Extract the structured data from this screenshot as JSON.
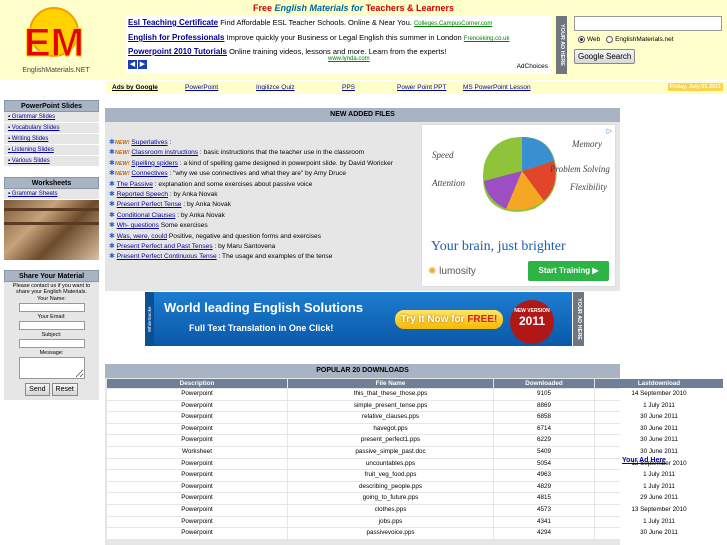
{
  "header": {
    "tagline_free": "Free",
    "tagline_em": "English Materials",
    "tagline_for": "for",
    "tagline_tl": "Teachers & Learners",
    "logo_text": "EM",
    "logo_sub": "EnglishMaterials.NET",
    "top_ads": [
      {
        "title": "Esl Teaching Certificate",
        "desc": "Find Affordable ESL Teacher Schools. Online & Near You.",
        "url": "Colleges.CampusCorner.com"
      },
      {
        "title": "English for Professionals",
        "desc": "Improve quickly your Business or Legal English this summer in London",
        "url": "Frenceking.co.uk"
      },
      {
        "title": "Powerpoint 2010 Tutorials",
        "desc": "Online training videos, lessons and more. Learn from the experts!",
        "url": "www.lynda.com"
      }
    ],
    "adchoices": "AdChoices",
    "nav_prev": "◀",
    "nav_next": "▶",
    "your_ad_here_vertical": "YOUR AD HERE",
    "search": {
      "input_value": "",
      "radio_web": "Web",
      "radio_site": "EnglishMaterials.net",
      "button": "Google Search"
    }
  },
  "navbar": {
    "ads_by_google": "Ads by Google",
    "links": [
      "PowerPoint",
      "Ingilizce Quiz",
      "PPS",
      "Power Point PPT",
      "MS PowerPoint Lesson"
    ],
    "date": "Friday, July 01 2011"
  },
  "sidebar": {
    "ppt_title": "PowerPoint Slides",
    "ppt_items": [
      "Grammar Slides",
      "Vocabulary Slides",
      "Writing Slides",
      "Listening Slides",
      "Various Slides"
    ],
    "ws_title": "Worksheets",
    "ws_items": [
      "Grammar Sheets"
    ],
    "share": {
      "title": "Share Your Material",
      "intro": "Please contact us if you want to share your English Materials.",
      "name": "Your Name:",
      "email": "Your Email:",
      "subject": "Subject:",
      "message": "Message:",
      "send": "Send",
      "reset": "Reset"
    }
  },
  "newfiles": {
    "title": "NEW ADDED FILES",
    "new_tag": "NEW!",
    "items": [
      {
        "link": "Superlatives",
        "text": " :",
        "new": true
      },
      {
        "link": "Classroom instructions",
        "text": " : basic instructions that the teacher use in the classroom",
        "new": true
      },
      {
        "link": "Spelling spiders",
        "text": " : a kind of spelling game designed in powerpoint slide. by David Woricker",
        "new": true
      },
      {
        "link": "Connectives",
        "text": " : \"why we use connectives and what they are\" by Amy Druce",
        "new": true
      },
      {
        "link": "The Passive",
        "text": " : explanation and some exercises about passive voice",
        "new": false
      },
      {
        "link": "Reported Speech",
        "text": " : by Anka Novak",
        "new": false
      },
      {
        "link": "Present Perfect Tense",
        "text": " : by Anka Novak",
        "new": false
      },
      {
        "link": "Conditional Clauses",
        "text": " : by Anka Novak",
        "new": false
      },
      {
        "link": "Wh- questions",
        "text": " Some exercises",
        "new": false
      },
      {
        "link": "Was, were, could",
        "text": " Positive, negative and question forms and exercises",
        "new": false
      },
      {
        "link": "Present Perfect and Past Tenses",
        "text": " : by Maru Santovena",
        "new": false
      },
      {
        "link": "Present Perfect Continuous Tense",
        "text": " : The usage and examples of the tense",
        "new": false
      }
    ]
  },
  "brain_ad": {
    "labels": [
      "Memory",
      "Speed",
      "Problem Solving",
      "Attention",
      "Flexibility"
    ],
    "headline": "Your brain, just brighter",
    "brand": "lumosity",
    "button": "Start Training ▶",
    "adchoice_icon": "▷"
  },
  "banner": {
    "title": "World leading English Solutions",
    "subtitle": "Full Text Translation in One Click!",
    "try": "Try It Now for ",
    "free": "FREE!",
    "badge_top": "NEW VERSION",
    "badge_year": "2011",
    "side": "WhiteSmoke"
  },
  "popular": {
    "title": "POPULAR 20 DOWNLOADS",
    "columns": [
      "Description",
      "File Name",
      "Downloaded",
      "Lastdownload"
    ],
    "rows": [
      [
        "Powerpoint",
        "this_that_these_those.pps",
        "9105",
        "14 September 2010"
      ],
      [
        "Powerpoint",
        "simple_present_tense.pps",
        "8869",
        "1 July 2011"
      ],
      [
        "Powerpoint",
        "relative_clauses.pps",
        "6858",
        "30 June 2011"
      ],
      [
        "Powerpoint",
        "havegot.pps",
        "6714",
        "30 June 2011"
      ],
      [
        "Powerpoint",
        "present_perfect1.pps",
        "6229",
        "30 June 2011"
      ],
      [
        "Worksheet",
        "passive_simple_past.doc",
        "5409",
        "30 June 2011"
      ],
      [
        "Powerpoint",
        "uncountables.pps",
        "5054",
        "12 September 2010"
      ],
      [
        "Powerpoint",
        "fruit_veg_food.pps",
        "4963",
        "1 July 2011"
      ],
      [
        "Powerpoint",
        "describing_people.pps",
        "4829",
        "1 July 2011"
      ],
      [
        "Powerpoint",
        "going_to_future.pps",
        "4815",
        "29 June 2011"
      ],
      [
        "Powerpoint",
        "clothes.pps",
        "4573",
        "13 September 2010"
      ],
      [
        "Powerpoint",
        "jobs.pps",
        "4341",
        "1 July 2011"
      ],
      [
        "Powerpoint",
        "passivevoice.pps",
        "4294",
        "30 June 2011"
      ]
    ]
  },
  "side_link": "Your Ad Here",
  "colors": {
    "header_bg": "#ffffcc",
    "section_header": "#a8b4c4",
    "table_header": "#6e7f97",
    "link": "#00009c"
  }
}
